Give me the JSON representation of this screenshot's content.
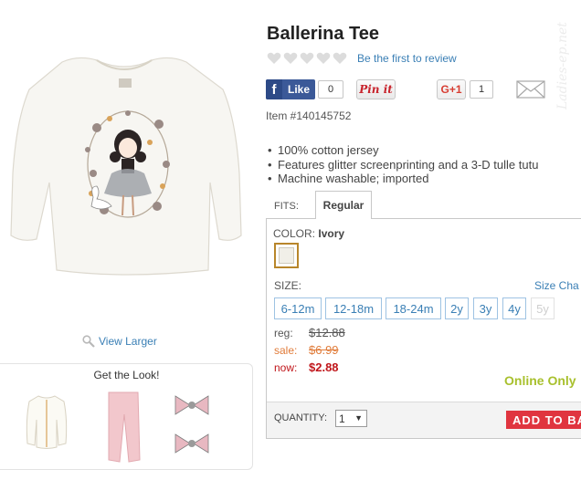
{
  "product": {
    "title": "Ballerina Tee",
    "review_link": "Be the first to review",
    "item_number": "Item #140145752",
    "features": [
      "100% cotton jersey",
      "Features glitter screenprinting and a 3-D tulle tutu",
      "Machine washable; imported"
    ],
    "view_larger": "View Larger"
  },
  "social": {
    "like_label": "Like",
    "like_count": "0",
    "pinit_label": "Pin it",
    "gplus_label": "G+1",
    "gplus_count": "1"
  },
  "watermark": "Ladies-ep.net",
  "fits": {
    "label": "FITS:",
    "active_tab": "Regular"
  },
  "color": {
    "label": "COLOR:",
    "value": "Ivory",
    "swatch_hex": "#f1efe8"
  },
  "size": {
    "label": "SIZE:",
    "chart_link": "Size Cha",
    "options": [
      "6-12m",
      "12-18m",
      "18-24m",
      "2y",
      "3y",
      "4y",
      "5y"
    ]
  },
  "price": {
    "reg_label": "reg:",
    "reg_value": "$12.88",
    "sale_label": "sale:",
    "sale_value": "$6.99",
    "now_label": "now:",
    "now_value": "$2.88",
    "online_only": "Online Only"
  },
  "quantity": {
    "label": "QUANTITY:",
    "value": "1"
  },
  "add_to_bag": "ADD TO BAG",
  "get_the_look": {
    "title": "Get the Look!"
  },
  "colors": {
    "link": "#3a7fb5",
    "sale": "#e07b39",
    "now": "#c0161b",
    "online_only": "#a8c02d",
    "add_button": "#e0353f",
    "facebook": "#3b5998"
  }
}
